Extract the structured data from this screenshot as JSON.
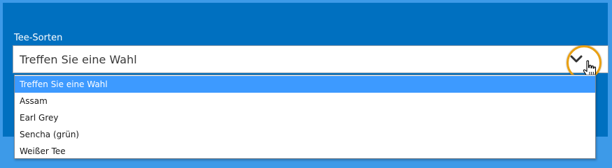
{
  "form": {
    "field_label": "Tee-Sorten",
    "select": {
      "current_value": "Treffen Sie eine Wahl",
      "options": [
        {
          "label": "Treffen Sie eine Wahl",
          "selected": true
        },
        {
          "label": "Assam",
          "selected": false
        },
        {
          "label": "Earl Grey",
          "selected": false
        },
        {
          "label": "Sencha (grün)",
          "selected": false
        },
        {
          "label": "Weißer Tee",
          "selected": false
        }
      ]
    }
  },
  "icons": {
    "dropdown_toggle": "chevron-down-icon",
    "pointer": "hand-pointer-cursor-icon"
  },
  "colors": {
    "panel_background": "#0070c0",
    "frame_background": "#3d9ae8",
    "option_highlight": "#3d9aff",
    "focus_ring": "#e9a012"
  }
}
